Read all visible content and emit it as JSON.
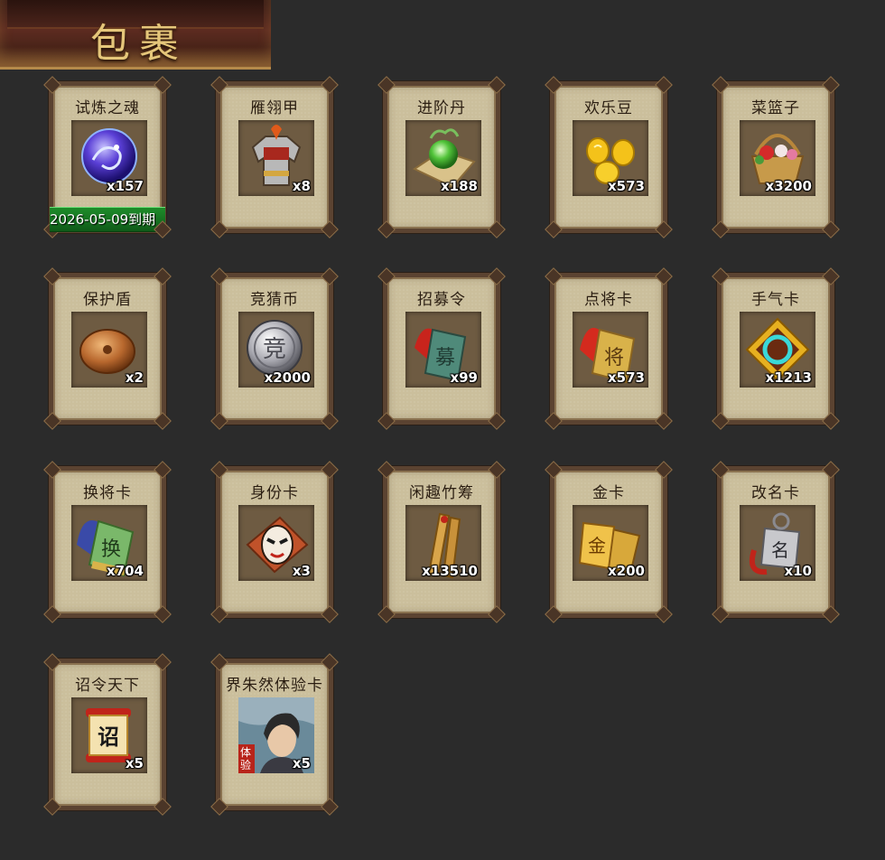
{
  "header": {
    "title": "包裹"
  },
  "items": [
    {
      "name": "试炼之魂",
      "qty": "x157",
      "icon": "blue-dragon-orb-icon",
      "expire": "2026-05-09到期"
    },
    {
      "name": "雁翎甲",
      "qty": "x8",
      "icon": "armor-icon"
    },
    {
      "name": "进阶丹",
      "qty": "x188",
      "icon": "green-pill-icon"
    },
    {
      "name": "欢乐豆",
      "qty": "x573",
      "icon": "gold-beans-icon"
    },
    {
      "name": "菜篮子",
      "qty": "x3200",
      "icon": "flower-basket-icon"
    },
    {
      "name": "保护盾",
      "qty": "x2",
      "icon": "shield-icon"
    },
    {
      "name": "竞猜币",
      "qty": "x2000",
      "icon": "silver-coin-icon",
      "glyph": "竞"
    },
    {
      "name": "招募令",
      "qty": "x99",
      "icon": "recruit-token-icon",
      "glyph": "募"
    },
    {
      "name": "点将卡",
      "qty": "x573",
      "icon": "general-card-icon",
      "glyph": "将"
    },
    {
      "name": "手气卡",
      "qty": "x1213",
      "icon": "luck-card-icon"
    },
    {
      "name": "换将卡",
      "qty": "x704",
      "icon": "swap-general-card-icon",
      "glyph": "换"
    },
    {
      "name": "身份卡",
      "qty": "x3",
      "icon": "opera-mask-card-icon"
    },
    {
      "name": "闲趣竹筹",
      "qty": "x13510",
      "icon": "bamboo-tally-icon"
    },
    {
      "name": "金卡",
      "qty": "x200",
      "icon": "gold-card-icon",
      "glyph": "金"
    },
    {
      "name": "改名卡",
      "qty": "x10",
      "icon": "rename-card-icon",
      "glyph": "名"
    },
    {
      "name": "诏令天下",
      "qty": "x5",
      "icon": "edict-scroll-icon",
      "glyph": "诏"
    },
    {
      "name": "界朱然体验卡",
      "qty": "x5",
      "icon": "hero-portrait-icon",
      "tag": "体验"
    }
  ]
}
